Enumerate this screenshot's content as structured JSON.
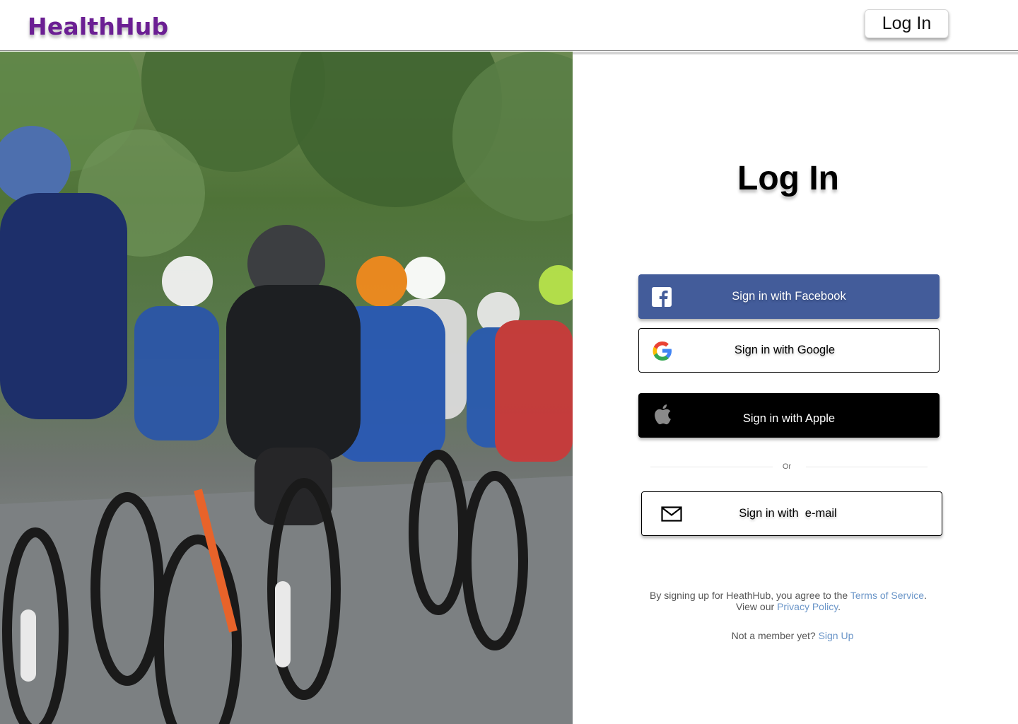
{
  "header": {
    "logo": "HealthHub",
    "login_button": "Log In"
  },
  "main": {
    "title": "Log In",
    "sso": {
      "facebook": "Sign in with Facebook",
      "google": "Sign in with Google",
      "apple": "Sign in with Apple",
      "email": "Sign in with  e-mail"
    },
    "divider_text": "Or",
    "legal": {
      "prefix": "By signing up for HeathHub, you agree to the ",
      "terms": "Terms of Service",
      "middle": ". View our ",
      "privacy": "Privacy Policy",
      "suffix": "."
    },
    "signup": {
      "prompt": "Not a member yet? ",
      "link": "Sign Up"
    }
  },
  "colors": {
    "brand": "#6b1f93",
    "facebook": "#435c9a",
    "link": "#6a95c8"
  },
  "icons": [
    "facebook-icon",
    "google-icon",
    "apple-icon",
    "mail-icon"
  ]
}
